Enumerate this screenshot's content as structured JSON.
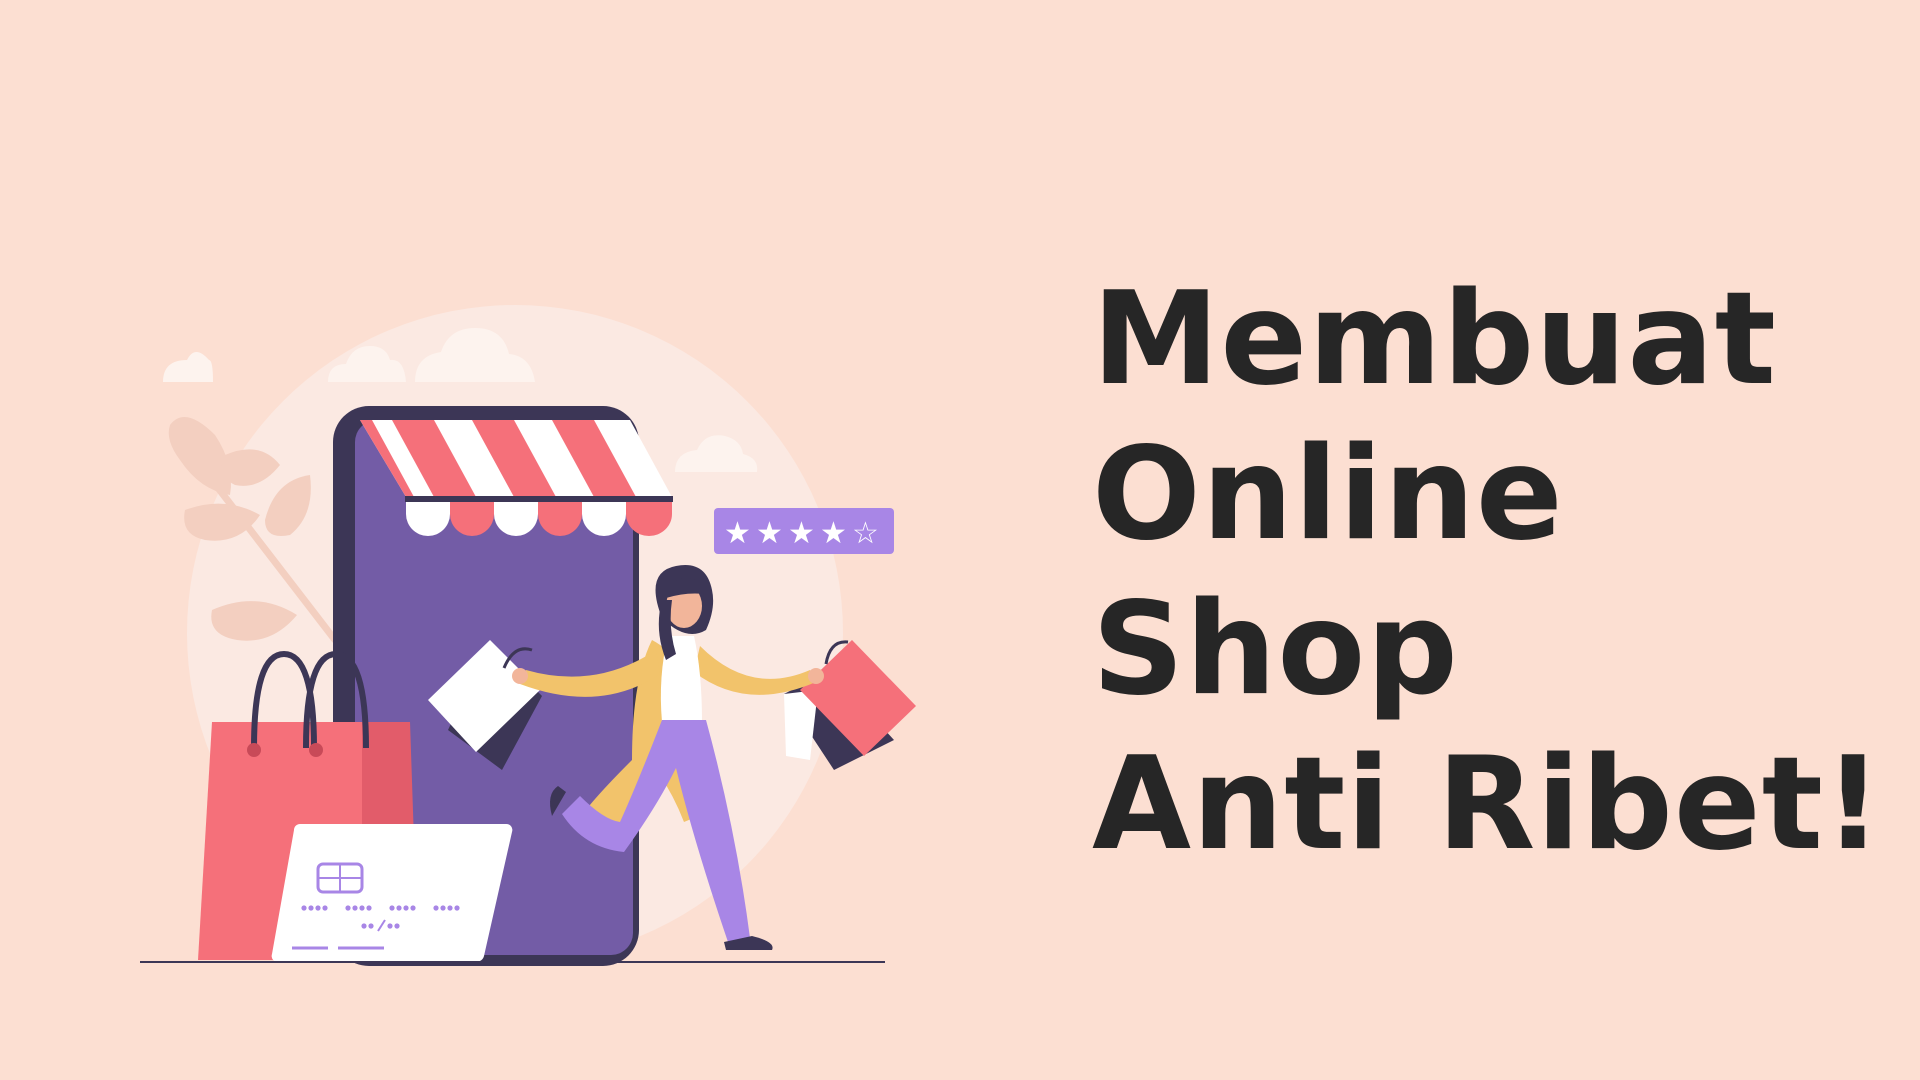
{
  "banner": {
    "background_color": "#fcdfd2",
    "headline_lines": [
      "Membuat",
      "Online",
      "Shop",
      "Anti Ribet!"
    ],
    "headline_color": "#262626"
  },
  "illustration": {
    "rating_stars": 4,
    "rating_max": 5,
    "icons": [
      "cloud-icon",
      "leaf-branch-icon",
      "phone-storefront-icon",
      "awning-icon",
      "shopping-bag-icon",
      "credit-card-icon",
      "woman-shopper-icon",
      "star-rating-icon"
    ],
    "colors": {
      "phone_body": "#3c3656",
      "phone_screen": "#735ca6",
      "awning_red": "#f5707a",
      "awning_white": "#ffffff",
      "bag_pink": "#f5707a",
      "bag_dark": "#3c3656",
      "rating_badge": "#a886e6",
      "trousers": "#a886e6",
      "jacket": "#f2c36b",
      "circle_bg": "#fbe9e2",
      "leaf": "#f3cfc0"
    }
  }
}
